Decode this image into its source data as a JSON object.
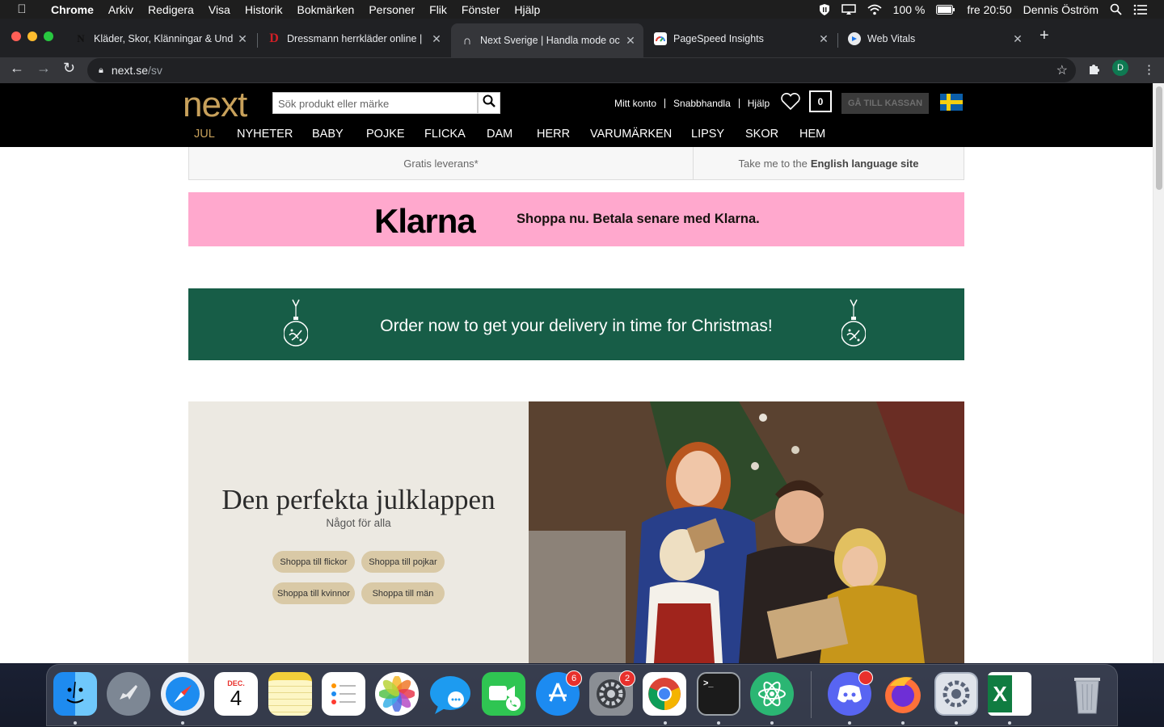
{
  "menubar": {
    "app_name": "Chrome",
    "items": [
      "Arkiv",
      "Redigera",
      "Visa",
      "Historik",
      "Bokmärken",
      "Personer",
      "Flik",
      "Fönster",
      "Hjälp"
    ],
    "battery": "100 %",
    "clock": "fre 20:50",
    "user": "Dennis Öström"
  },
  "tabs": [
    {
      "title": "Kläder, Skor, Klänningar & Und",
      "favicon": "N"
    },
    {
      "title": "Dressmann herrkläder online |",
      "favicon": "D"
    },
    {
      "title": "Next Sverige | Handla mode oc",
      "favicon": "∩"
    },
    {
      "title": "PageSpeed Insights",
      "favicon": "ps"
    },
    {
      "title": "Web Vitals",
      "favicon": "wv"
    }
  ],
  "omnibox": {
    "host": "next.se",
    "path": "/sv"
  },
  "profile_initial": "D",
  "site": {
    "logo": "next",
    "search_placeholder": "Sök produkt eller märke",
    "links": [
      "Mitt konto",
      "Snabbhandla",
      "Hjälp"
    ],
    "bag_count": "0",
    "checkout_label": "GÅ TILL KASSAN",
    "nav": [
      "JUL",
      "NYHETER",
      "BABY",
      "POJKE",
      "FLICKA",
      "DAM",
      "HERR",
      "VARUMÄRKEN",
      "LIPSY",
      "SKOR",
      "HEM"
    ],
    "nav_active_color": "#c8a15b",
    "info_delivery": "Gratis leverans*",
    "info_english_prefix": "Take me to the",
    "info_english_bold": "English language site"
  },
  "klarna": {
    "logo": "Klarna",
    "text": "Shoppa nu. Betala senare med Klarna.",
    "bg": "#ffa8cd"
  },
  "xmas_banner": {
    "text": "Order now to get your delivery in time for Christmas!",
    "bg": "#175d47"
  },
  "hero": {
    "title": "Den perfekta julklappen",
    "subtitle": "Något för alla",
    "buttons": [
      "Shoppa till flickor",
      "Shoppa till pojkar",
      "Shoppa till kvinnor",
      "Shoppa till män"
    ]
  },
  "dock": {
    "apps": [
      "finder",
      "launchpad",
      "safari",
      "calendar",
      "notes",
      "reminders",
      "photos",
      "messages",
      "facetime",
      "app-store",
      "system-preferences",
      "chrome",
      "terminal",
      "atom",
      "discord",
      "firefox",
      "network-utility",
      "excel",
      "trash"
    ],
    "calendar_month": "DEC.",
    "calendar_day": "4",
    "app_store_badge": "6",
    "system_preferences_badge": "2"
  }
}
